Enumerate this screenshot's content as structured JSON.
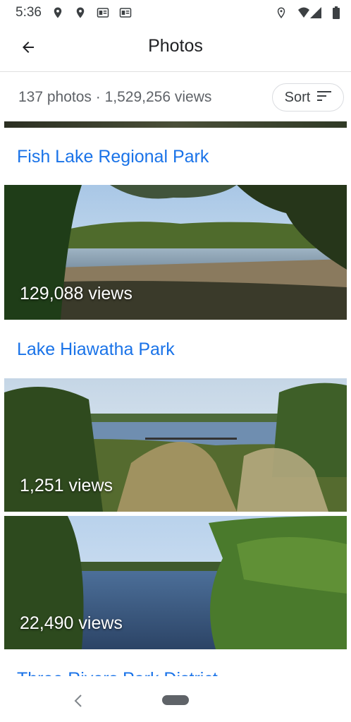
{
  "status_bar": {
    "time": "5:36"
  },
  "app_bar": {
    "title": "Photos"
  },
  "summary": {
    "text": "137 photos · 1,529,256 views",
    "sort_label": "Sort"
  },
  "sections": [
    {
      "title": "Fish Lake Regional Park",
      "photos": [
        {
          "views": "129,088 views"
        }
      ]
    },
    {
      "title": "Lake Hiawatha Park",
      "photos": [
        {
          "views": "1,251 views"
        },
        {
          "views": "22,490 views"
        }
      ]
    },
    {
      "title": "Three Rivers Park District"
    }
  ]
}
